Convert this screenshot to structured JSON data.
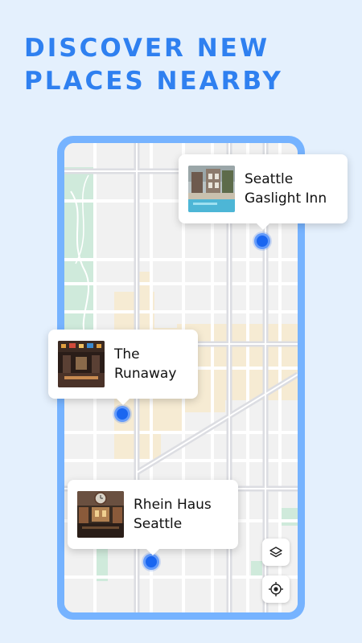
{
  "headline": {
    "line1": "DISCOVER NEW",
    "line2": "PLACES NEARBY"
  },
  "colors": {
    "accent": "#2f80f0",
    "pin": "#1a66f0",
    "phone_frame": "#76b3ff",
    "background": "#e4f0fd"
  },
  "places": [
    {
      "line1": "Seattle",
      "line2": "Gaslight Inn",
      "thumbnail": "hotel-pool-photo"
    },
    {
      "line1": "The",
      "line2": "Runaway",
      "thumbnail": "bar-interior-photo"
    },
    {
      "line1": "Rhein Haus",
      "line2": "Seattle",
      "thumbnail": "beer-hall-photo"
    }
  ],
  "map_controls": [
    {
      "icon": "layers-icon"
    },
    {
      "icon": "my-location-icon"
    }
  ]
}
